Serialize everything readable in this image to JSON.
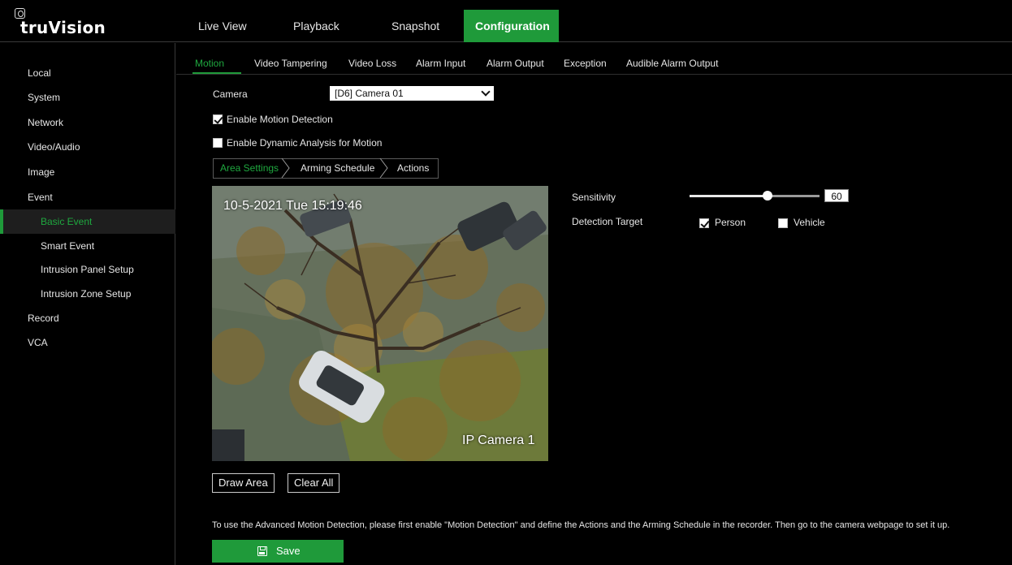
{
  "app": {
    "logo": "truVision"
  },
  "nav": [
    {
      "label": "Live View"
    },
    {
      "label": "Playback"
    },
    {
      "label": "Snapshot"
    },
    {
      "label": "Configuration"
    }
  ],
  "sidebar": {
    "items": [
      {
        "label": "Local"
      },
      {
        "label": "System"
      },
      {
        "label": "Network"
      },
      {
        "label": "Video/Audio"
      },
      {
        "label": "Image"
      },
      {
        "label": "Event"
      },
      {
        "label": "Basic Event"
      },
      {
        "label": "Smart Event"
      },
      {
        "label": "Intrusion Panel Setup"
      },
      {
        "label": "Intrusion Zone Setup"
      },
      {
        "label": "Record"
      },
      {
        "label": "VCA"
      }
    ]
  },
  "subtabs": [
    {
      "label": "Motion"
    },
    {
      "label": "Video Tampering"
    },
    {
      "label": "Video Loss"
    },
    {
      "label": "Alarm Input"
    },
    {
      "label": "Alarm Output"
    },
    {
      "label": "Exception"
    },
    {
      "label": "Audible Alarm Output"
    }
  ],
  "form": {
    "camera_label": "Camera",
    "camera_value": "[D6] Camera 01",
    "enable_motion_label": "Enable Motion Detection",
    "enable_motion_checked": true,
    "enable_dynamic_label": "Enable Dynamic Analysis for Motion",
    "enable_dynamic_checked": false
  },
  "steps": [
    {
      "label": "Area Settings"
    },
    {
      "label": "Arming Schedule"
    },
    {
      "label": "Actions"
    }
  ],
  "video": {
    "timestamp": "10-5-2021 Tue 15:19:46",
    "camera_name": "IP Camera 1"
  },
  "buttons": {
    "draw_area": "Draw Area",
    "clear_all": "Clear All",
    "save": "Save"
  },
  "settings": {
    "sensitivity_label": "Sensitivity",
    "sensitivity_value": "60",
    "sensitivity_fraction": 0.6,
    "detection_target_label": "Detection Target",
    "person_label": "Person",
    "person_checked": true,
    "vehicle_label": "Vehicle",
    "vehicle_checked": false
  },
  "info_text": "To use the Advanced Motion Detection, please first enable \"Motion Detection\" and define the Actions and the Arming Schedule in the recorder. Then go to the camera webpage to set it up.",
  "colors": {
    "accent": "#1f9a3a",
    "accent_text": "#1fa83f",
    "background": "#000000"
  }
}
